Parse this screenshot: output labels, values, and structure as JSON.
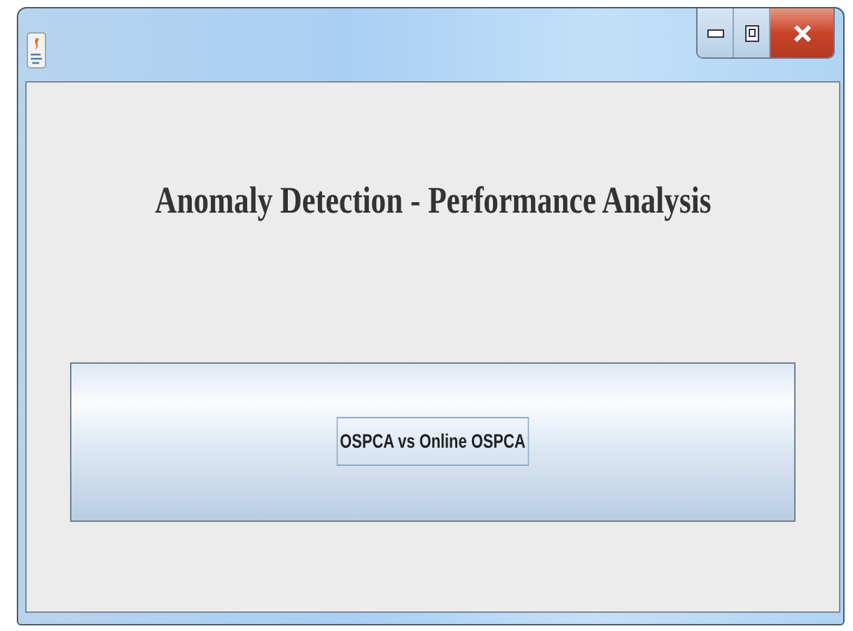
{
  "window": {
    "title": "Anomaly Detection - Performance Analysis"
  },
  "buttons": [
    {
      "label": "OSPCA vs Online OSPCA",
      "focused": true
    }
  ]
}
